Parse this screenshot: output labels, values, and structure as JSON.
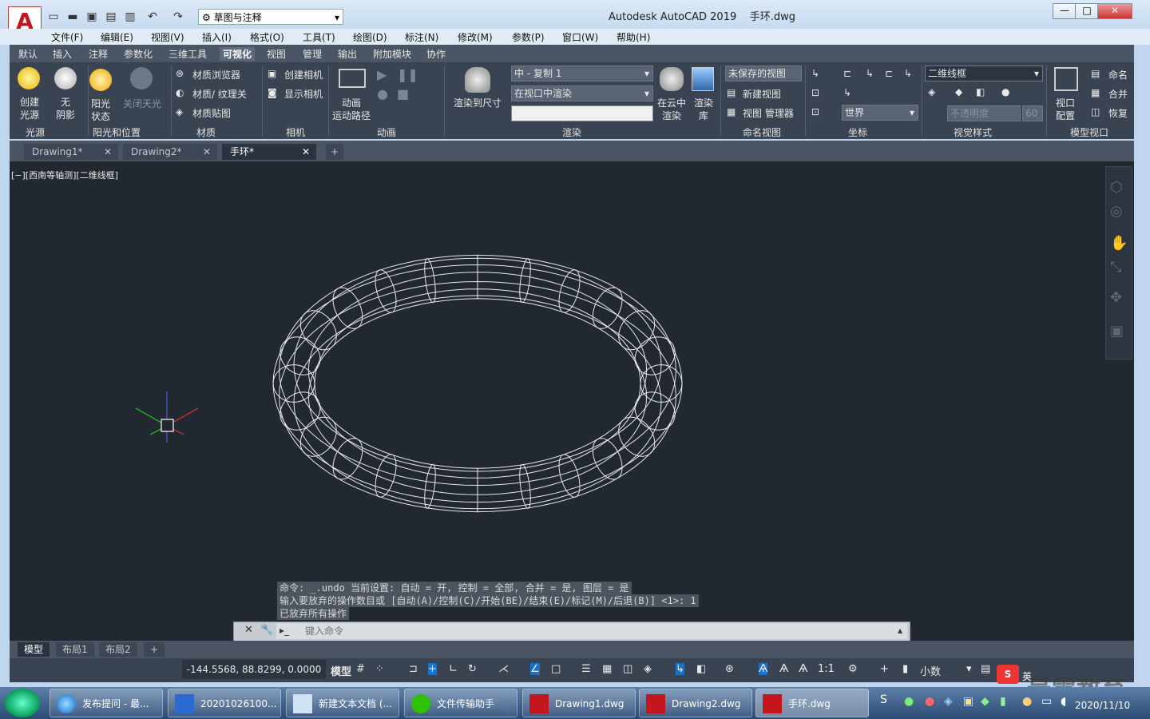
{
  "titlebar": {
    "workspace": "草图与注释",
    "app_title": "Autodesk AutoCAD 2019",
    "file_name": "手环.dwg"
  },
  "menu": [
    "文件(F)",
    "编辑(E)",
    "视图(V)",
    "插入(I)",
    "格式(O)",
    "工具(T)",
    "绘图(D)",
    "标注(N)",
    "修改(M)",
    "参数(P)",
    "窗口(W)",
    "帮助(H)"
  ],
  "ribbon_tabs": [
    "默认",
    "插入",
    "注释",
    "参数化",
    "三维工具",
    "可视化",
    "视图",
    "管理",
    "输出",
    "附加模块",
    "协作"
  ],
  "ribbon_active_tab": "可视化",
  "ribbon": {
    "light": {
      "create_light_l1": "创建",
      "create_light_l2": "光源",
      "no_shadow_l1": "无",
      "no_shadow_l2": "阴影",
      "sun_l1": "阳光",
      "sun_l2": "状态",
      "sky_off": "关闭天光",
      "panel": "光源"
    },
    "sun_panel": "阳光和位置",
    "materials": {
      "browser": "材质浏览器",
      "texture": "材质/ 纹理关",
      "mapping": "材质贴图",
      "panel": "材质"
    },
    "camera": {
      "create": "创建相机",
      "show": "显示相机",
      "panel": "相机"
    },
    "animation": {
      "path_l1": "动画",
      "path_l2": "运动路径",
      "panel": "动画"
    },
    "render": {
      "render_to_size": "渲染到尺寸",
      "preset": "中 - 复制 1",
      "target": "在视口中渲染",
      "cloud_l1": "在云中",
      "cloud_l2": "渲染",
      "library_l1": "渲染",
      "library_l2": "库",
      "panel": "渲染"
    },
    "named_views": {
      "unsaved": "未保存的视图",
      "new_view": "新建视图",
      "manager": "视图 管理器",
      "panel": "命名视图"
    },
    "coordinates": {
      "world": "世界",
      "panel": "坐标"
    },
    "visual_styles": {
      "style": "二维线框",
      "opacity_label": "不透明度",
      "opacity_value": "60",
      "panel": "视觉样式"
    },
    "model_viewports": {
      "config_l1": "视口",
      "config_l2": "配置",
      "name": "命名",
      "join": "合并",
      "restore": "恢复",
      "panel": "模型视口"
    }
  },
  "doc_tabs": [
    {
      "label": "Drawing1*",
      "active": false
    },
    {
      "label": "Drawing2*",
      "active": false
    },
    {
      "label": "手环*",
      "active": true
    }
  ],
  "viewport_label": "[−][西南等轴测][二维线框]",
  "command_history": [
    "命令: _.undo 当前设置: 自动 = 开, 控制 = 全部, 合并 = 是, 图层 = 是",
    "输入要放弃的操作数目或 [自动(A)/控制(C)/开始(BE)/结束(E)/标记(M)/后退(B)] <1>: 1",
    "已放弃所有操作"
  ],
  "command_placeholder": "键入命令",
  "layout_tabs": [
    "模型",
    "布局1",
    "布局2"
  ],
  "status": {
    "coords": "-144.5568, 88.8299, 0.0000",
    "model": "模型",
    "scale": "1:1",
    "units": "小数"
  },
  "taskbar": {
    "items": [
      "发布提问 - 最...",
      "20201026100...",
      "新建文本文档 (...",
      "文件传输助手",
      "Drawing1.dwg",
      "Drawing2.dwg",
      "手环.dwg"
    ],
    "ime": "英",
    "date": "2020/11/10"
  },
  "watermark": "最需教育",
  "colors": {
    "canvas": "#212830",
    "ribbon": "#3a4352",
    "wire": "#e8e8e8",
    "autocad_red": "#c4161c"
  }
}
